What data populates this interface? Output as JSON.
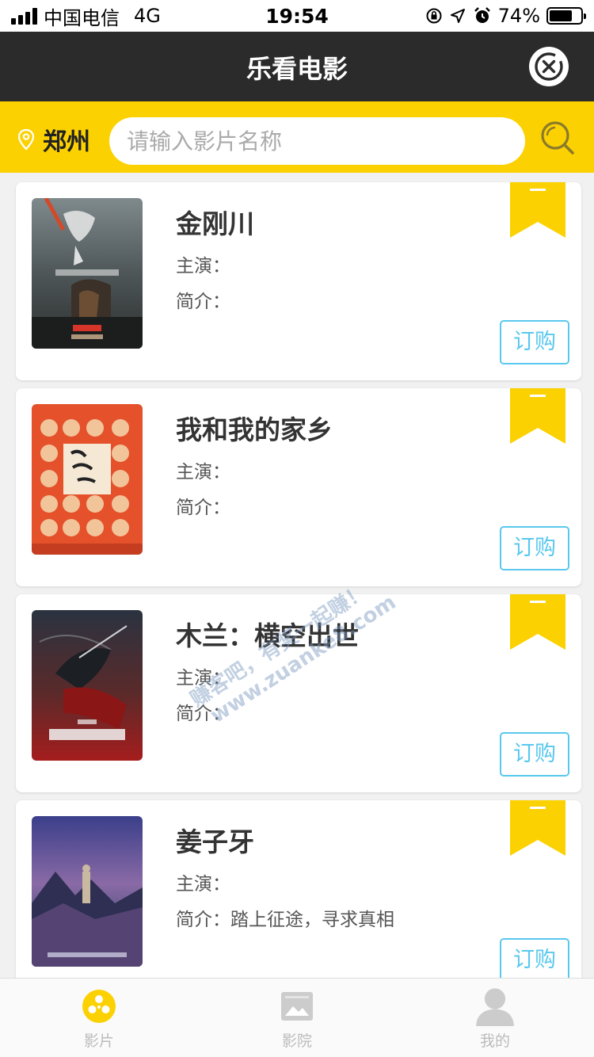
{
  "status_bar": {
    "carrier": "中国电信",
    "network": "4G",
    "time": "19:54",
    "battery": "74%",
    "battery_level": 0.74
  },
  "nav": {
    "title": "乐看电影",
    "close_icon": "close-circle-icon"
  },
  "search": {
    "location_icon": "location-pin-icon",
    "city": "郑州",
    "placeholder": "请输入影片名称",
    "value": "",
    "search_icon": "search-icon"
  },
  "colors": {
    "accent_yellow": "#fcd102",
    "nav_dark": "#2b2b2b",
    "order_blue": "#59c8ee",
    "tab_active": "#fcd102",
    "tab_inactive": "#cccccc"
  },
  "movies": [
    {
      "title": "金刚川",
      "actor_label": "主演：",
      "actor_value": "",
      "intro_label": "简介：",
      "intro_value": "",
      "order_label": "订购"
    },
    {
      "title": "我和我的家乡",
      "actor_label": "主演：",
      "actor_value": "",
      "intro_label": "简介：",
      "intro_value": "",
      "order_label": "订购"
    },
    {
      "title": "木兰：横空出世",
      "actor_label": "主演：",
      "actor_value": "",
      "intro_label": "简介：",
      "intro_value": "",
      "order_label": "订购"
    },
    {
      "title": "姜子牙",
      "actor_label": "主演：",
      "actor_value": "",
      "intro_label": "简介：",
      "intro_value": "踏上征途，寻求真相",
      "order_label": "订购"
    }
  ],
  "watermark": {
    "line1": "赚客吧，有奖一起赚！",
    "line2": "www.zuanke8.com"
  },
  "tabs": [
    {
      "label": "影片",
      "icon": "film-reel-icon",
      "active": true
    },
    {
      "label": "影院",
      "icon": "cinema-screen-icon",
      "active": false
    },
    {
      "label": "我的",
      "icon": "user-icon",
      "active": false
    }
  ]
}
